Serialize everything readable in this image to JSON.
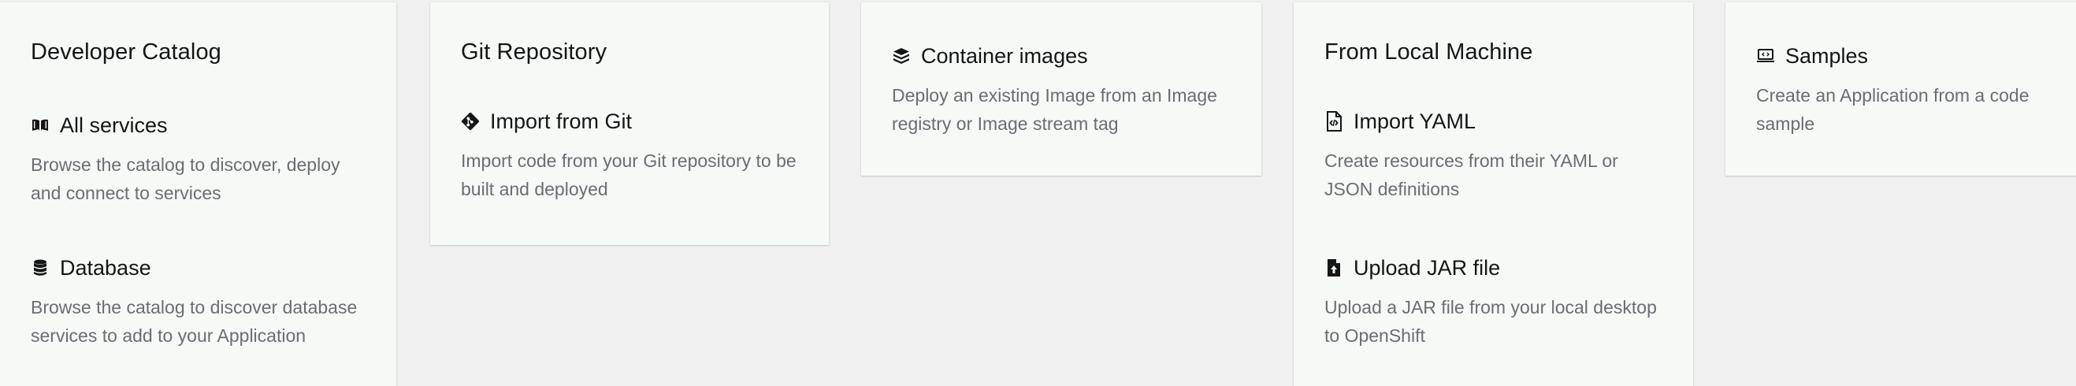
{
  "cards": {
    "developer_catalog": {
      "title": "Developer Catalog",
      "items": [
        {
          "icon": "book-open-icon",
          "label": "All services",
          "description": "Browse the catalog to discover, deploy and connect to services"
        },
        {
          "icon": "database-icon",
          "label": "Database",
          "description": "Browse the catalog to discover database services to add to your Application"
        }
      ]
    },
    "git_repository": {
      "title": "Git Repository",
      "items": [
        {
          "icon": "git-icon",
          "label": "Import from Git",
          "description": "Import code from your Git repository to be built and deployed"
        }
      ]
    },
    "container_images": {
      "items": [
        {
          "icon": "cubes-icon",
          "label": "Container images",
          "description": "Deploy an existing Image from an Image registry or Image stream tag"
        }
      ]
    },
    "from_local_machine": {
      "title": "From Local Machine",
      "items": [
        {
          "icon": "file-code-icon",
          "label": "Import YAML",
          "description": "Create resources from their YAML or JSON definitions"
        },
        {
          "icon": "file-upload-icon",
          "label": "Upload JAR file",
          "description": "Upload a JAR file from your local desktop to OpenShift"
        }
      ]
    },
    "samples": {
      "items": [
        {
          "icon": "laptop-code-icon",
          "label": "Samples",
          "description": "Create an Application from a code sample"
        }
      ]
    }
  },
  "colors": {
    "page_background": "#f0f0f0",
    "card_background": "#f5faf7",
    "title_text": "#151515",
    "description_text": "#6a6e73"
  }
}
